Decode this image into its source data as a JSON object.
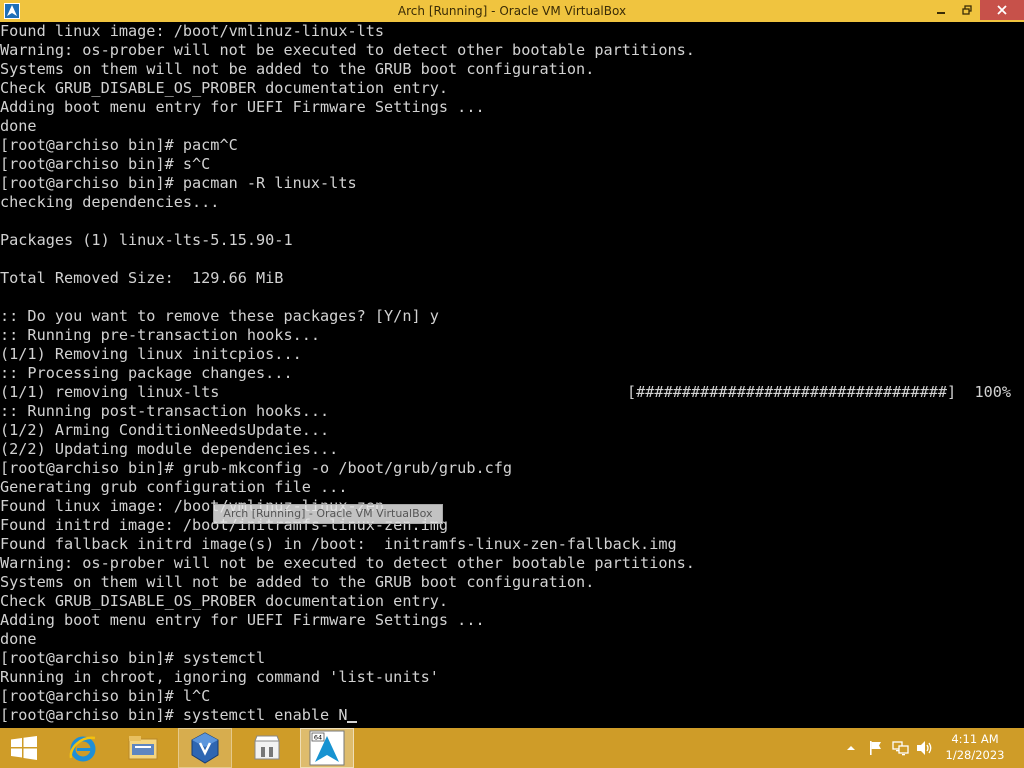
{
  "window": {
    "title": "Arch [Running] - Oracle VM VirtualBox",
    "icon": "virtualbox-icon"
  },
  "terminal": {
    "lines": [
      "Found linux image: /boot/vmlinuz-linux-lts",
      "Warning: os-prober will not be executed to detect other bootable partitions.",
      "Systems on them will not be added to the GRUB boot configuration.",
      "Check GRUB_DISABLE_OS_PROBER documentation entry.",
      "Adding boot menu entry for UEFI Firmware Settings ...",
      "done",
      "[root@archiso bin]# pacm^C",
      "[root@archiso bin]# s^C",
      "[root@archiso bin]# pacman -R linux-lts",
      "checking dependencies...",
      "",
      "Packages (1) linux-lts-5.15.90-1",
      "",
      "Total Removed Size:  129.66 MiB",
      "",
      ":: Do you want to remove these packages? [Y/n] y",
      ":: Running pre-transaction hooks...",
      "(1/1) Removing linux initcpios...",
      ":: Processing package changes...",
      "(1/1) removing linux-lts",
      ":: Running post-transaction hooks...",
      "(1/2) Arming ConditionNeedsUpdate...",
      "(2/2) Updating module dependencies...",
      "[root@archiso bin]# grub-mkconfig -o /boot/grub/grub.cfg",
      "Generating grub configuration file ...",
      "Found linux image: /boot/vmlinuz-linux-zen",
      "Found initrd image: /boot/initramfs-linux-zen.img",
      "Found fallback initrd image(s) in /boot:  initramfs-linux-zen-fallback.img",
      "Warning: os-prober will not be executed to detect other bootable partitions.",
      "Systems on them will not be added to the GRUB boot configuration.",
      "Check GRUB_DISABLE_OS_PROBER documentation entry.",
      "Adding boot menu entry for UEFI Firmware Settings ...",
      "done",
      "[root@archiso bin]# systemctl",
      "Running in chroot, ignoring command 'list-units'",
      "[root@archiso bin]# l^C",
      "[root@archiso bin]# systemctl enable N"
    ],
    "progress_text": "[##################################]  100%",
    "progress_value": 1.0
  },
  "tooltip": {
    "text": "Arch [Running] - Oracle VM VirtualBox"
  },
  "taskbar": {
    "apps": [
      {
        "name": "internet-explorer-icon"
      },
      {
        "name": "file-explorer-icon"
      },
      {
        "name": "virtualbox-manager-icon"
      },
      {
        "name": "store-icon"
      },
      {
        "name": "arch-vm-icon",
        "badge": "64"
      }
    ],
    "tray_icons": [
      "show-hidden-icons",
      "flag-icon",
      "network-icon",
      "volume-icon"
    ],
    "time": "4:11 AM",
    "date": "1/28/2023"
  },
  "colors": {
    "titlebar": "#f0c43f",
    "taskbar": "#cf9c28",
    "terminal_bg": "#000000",
    "terminal_fg": "#d2d2d2",
    "close_button": "#c7514a"
  }
}
